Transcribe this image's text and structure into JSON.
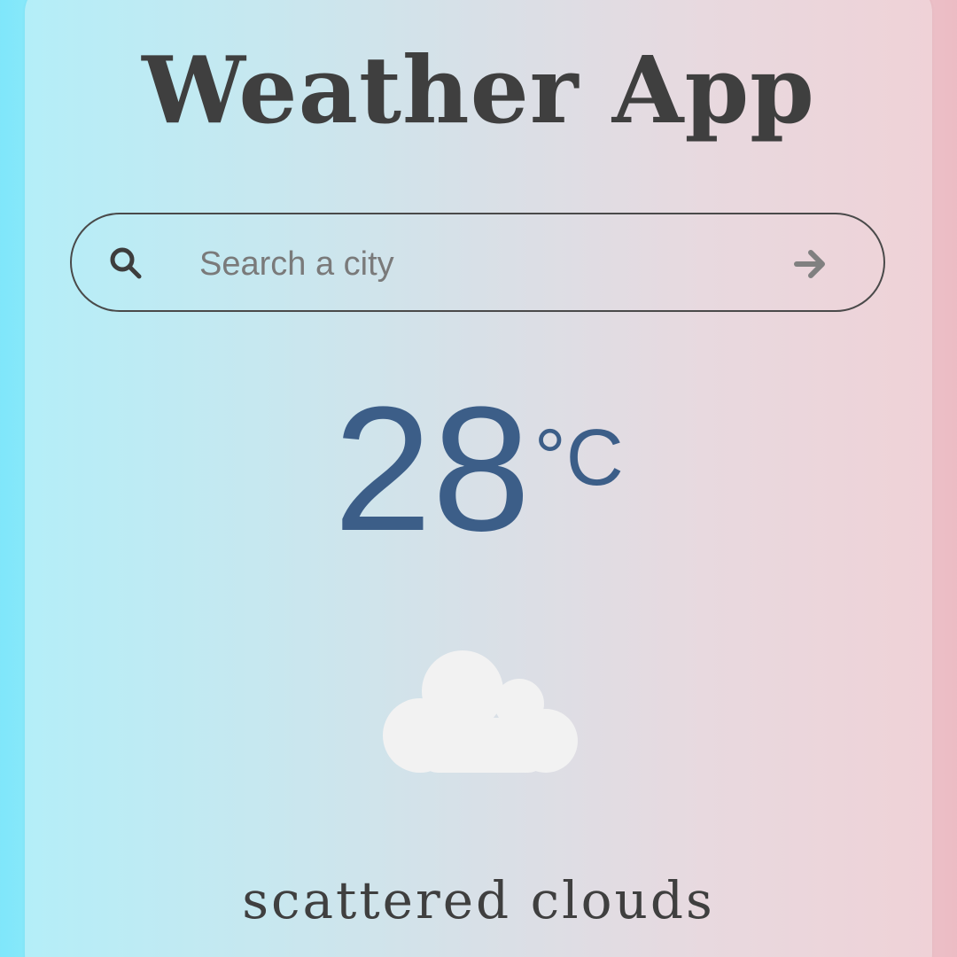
{
  "app": {
    "title": "Weather App"
  },
  "search": {
    "placeholder": "Search a city",
    "value": "",
    "icon": "search-icon",
    "submit_icon": "arrow-right-icon"
  },
  "weather": {
    "temperature": "28",
    "unit": "°C",
    "condition_icon": "cloud-icon",
    "description": "scattered clouds"
  },
  "colors": {
    "background_left": "#7fe7fb",
    "background_right": "#ecbcc4",
    "title_text": "#3f3f3f",
    "temperature_text": "#3c5e88",
    "cloud": "#f2f2f2"
  }
}
